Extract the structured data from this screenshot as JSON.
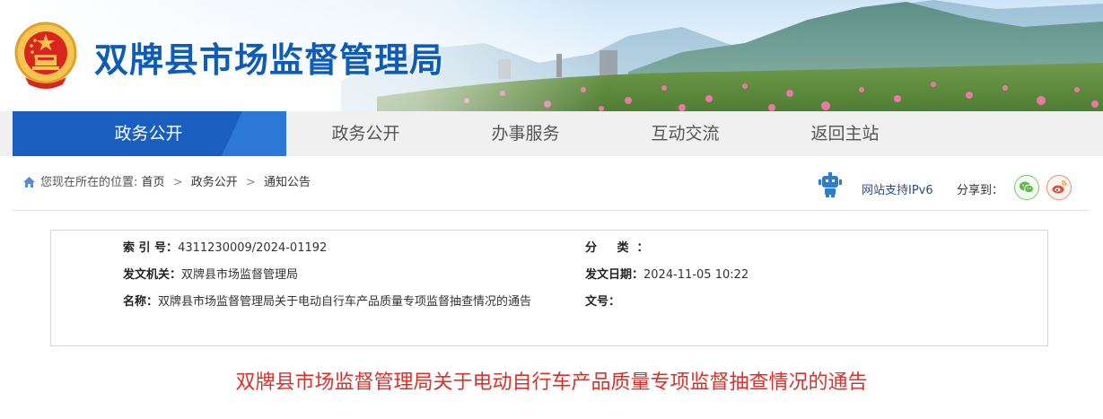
{
  "site": {
    "title": "双牌县市场监督管理局"
  },
  "nav": {
    "items": [
      {
        "label": "政务公开",
        "active": true
      },
      {
        "label": "政务公开",
        "active": false
      },
      {
        "label": "办事服务",
        "active": false
      },
      {
        "label": "互动交流",
        "active": false
      },
      {
        "label": "返回主站",
        "active": false
      }
    ]
  },
  "breadcrumb": {
    "prefix": "您现在所在的位置:",
    "items": [
      "首页",
      "政务公开",
      "通知公告"
    ],
    "separator": ">"
  },
  "toolbar": {
    "ipv6_label": "网站支持IPv6",
    "share_label": "分享到："
  },
  "meta": {
    "index_label": "索 引 号：",
    "index_value": "4311230009/2024-01192",
    "class_label": "分 类：",
    "class_value": "",
    "org_label": "发文机关：",
    "org_value": "双牌县市场监督管理局",
    "date_label": "发文日期：",
    "date_value": "2024-11-05 10:22",
    "name_label": "名称：",
    "name_value": "双牌县市场监督管理局关于电动自行车产品质量专项监督抽查情况的通告",
    "number_label": "文号：",
    "number_value": ""
  },
  "article": {
    "title": "双牌县市场监督管理局关于电动自行车产品质量专项监督抽查情况的通告"
  },
  "colors": {
    "brand_blue": "#1a5fbf",
    "title_blue": "#0d5cb6",
    "article_red": "#d8312b",
    "nav_bg": "#f0f0f0"
  },
  "icons": [
    "national-emblem-icon",
    "home-icon",
    "robot-icon",
    "wechat-icon",
    "weibo-icon"
  ]
}
